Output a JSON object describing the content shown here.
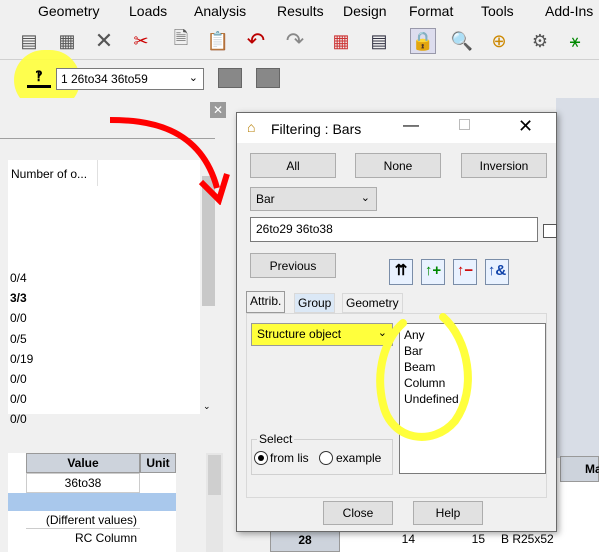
{
  "menu": [
    "Geometry",
    "Loads",
    "Analysis",
    "Results",
    "Design",
    "Format",
    "Tools",
    "Add-Ins"
  ],
  "toolbar_icons": [
    "copy-icon",
    "cut-icon",
    "delete-icon",
    "scissors-icon",
    "page-icon",
    "paste-icon",
    "undo-icon",
    "redo-icon",
    "calculator-icon",
    "table-icon",
    "lock-icon",
    "zoom-icon",
    "zoom-window-icon",
    "settings-icon",
    "node-icon"
  ],
  "selection": {
    "combo_value": "1 26to34 36to59"
  },
  "left_grid": {
    "header": "Number of o...",
    "rows": [
      "0/4",
      "3/3",
      "0/0",
      "0/5",
      "0/19",
      "0/0",
      "0/0",
      "0/0"
    ]
  },
  "bottom_table": {
    "headers": [
      "Value",
      "Unit"
    ],
    "rows": [
      "36to38",
      "",
      "(Different values)",
      "RC Column"
    ]
  },
  "dialog": {
    "title": "Filtering : Bars",
    "btn_all": "All",
    "btn_none": "None",
    "btn_inversion": "Inversion",
    "type_select": "Bar",
    "list_field": "26to29 36to38",
    "btn_previous": "Previous",
    "tabs": [
      "Attrib.",
      "Group",
      "Geometry"
    ],
    "attrib_select": "Structure object",
    "list_options": [
      "Any",
      "Bar",
      "Beam",
      "Column",
      "Undefined"
    ],
    "select_group_label": "Select",
    "radio_from_list": "from lis",
    "radio_example": "example",
    "btn_close": "Close",
    "btn_help": "Help"
  },
  "right_table": {
    "header": "Ma",
    "row_id": "28",
    "cells": [
      "14",
      "15",
      "B R25x52"
    ]
  }
}
